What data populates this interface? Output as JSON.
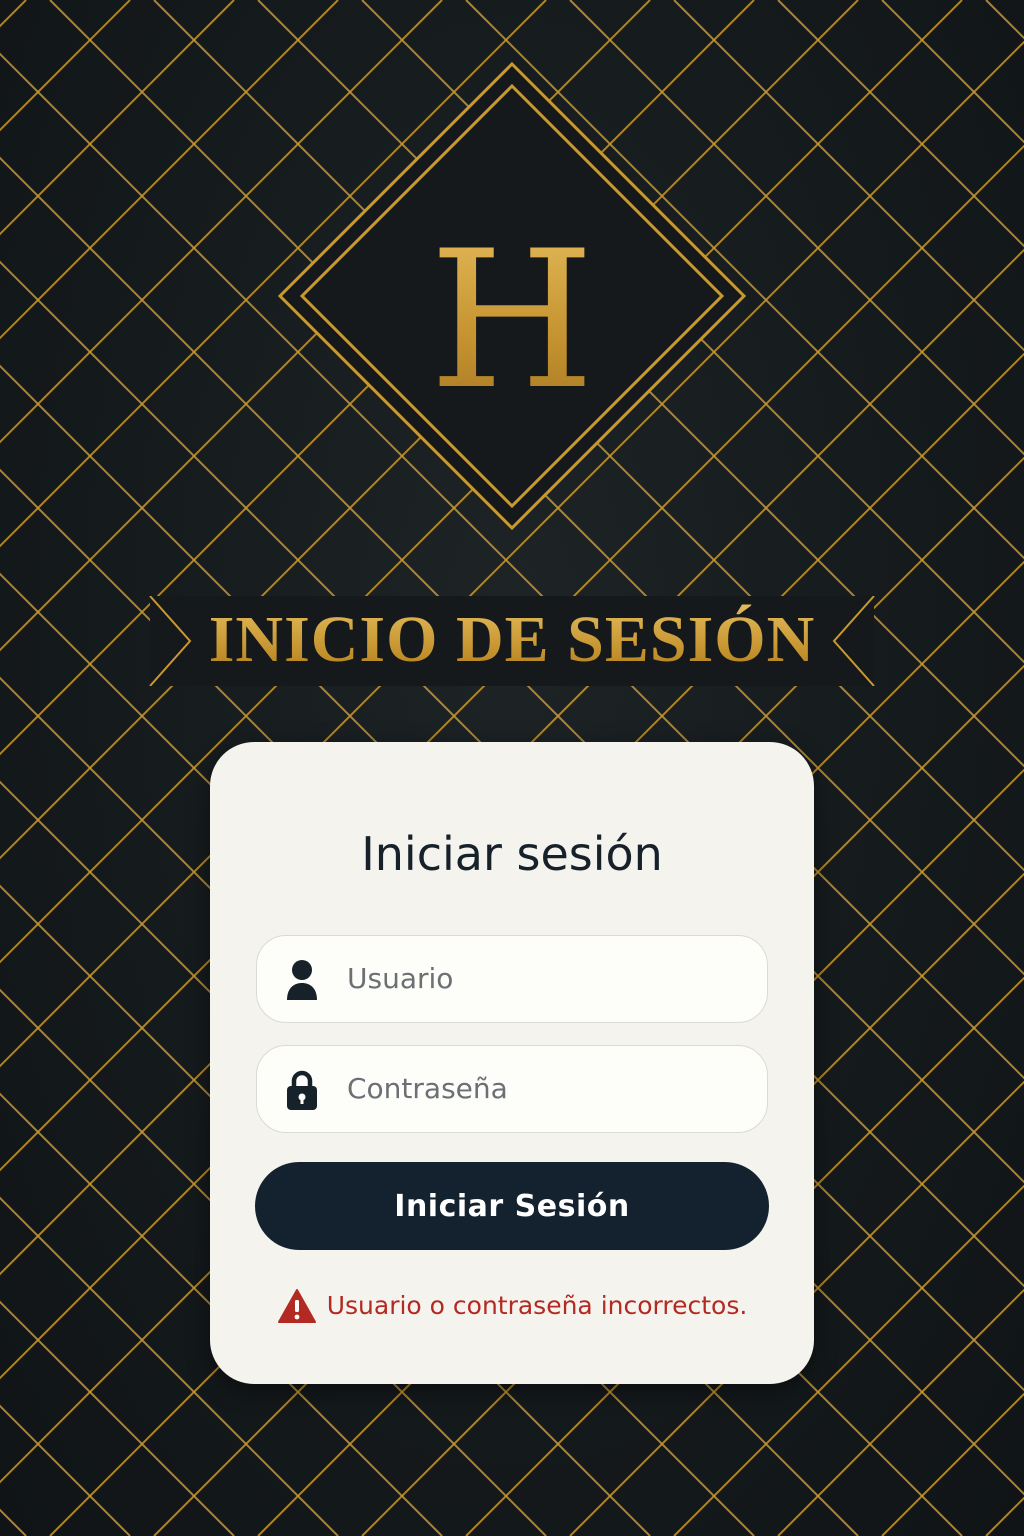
{
  "logo": {
    "letter": "H"
  },
  "header": {
    "title": "INICIO DE SESIÓN"
  },
  "login_card": {
    "title": "Iniciar sesión",
    "username": {
      "icon": "user-icon",
      "placeholder": "Usuario",
      "value": ""
    },
    "password": {
      "icon": "lock-icon",
      "placeholder": "Contraseña",
      "value": ""
    },
    "submit_label": "Iniciar Sesión",
    "error": {
      "icon": "warning-icon",
      "message": "Usuario o contraseña incorrectos."
    }
  },
  "colors": {
    "background": "#14191b",
    "gold": "#c9982f",
    "card": "#f5f3ee",
    "button": "#14222f",
    "error": "#b32a22"
  }
}
